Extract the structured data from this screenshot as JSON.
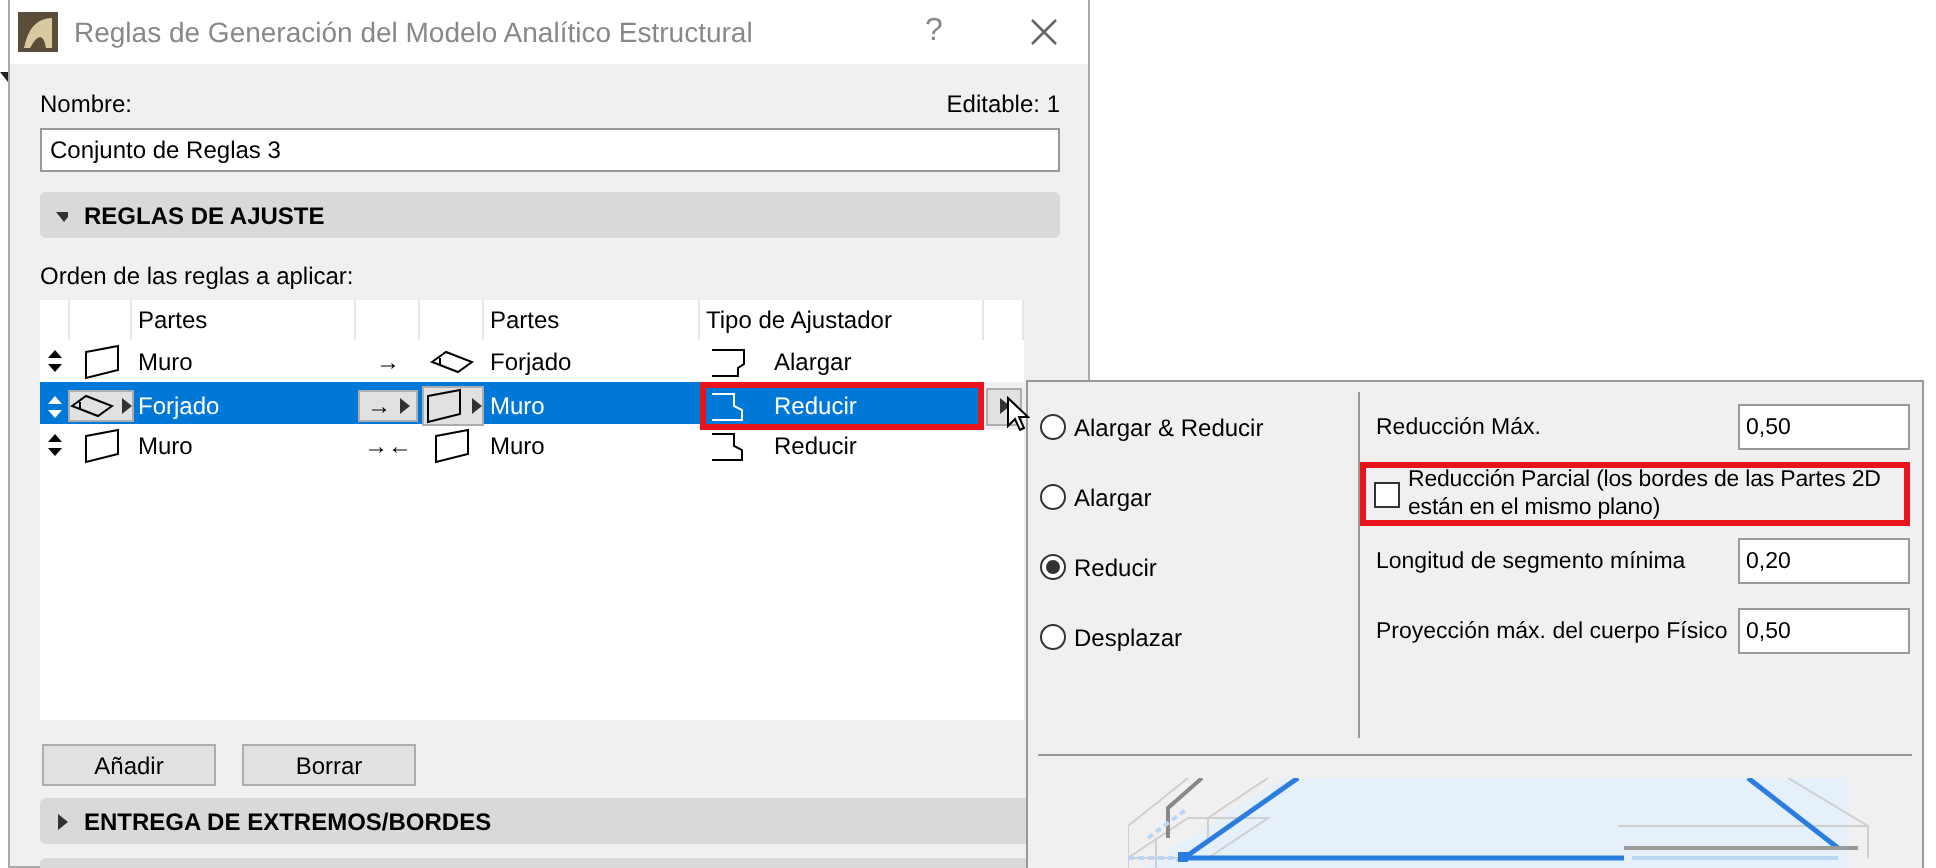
{
  "window": {
    "title": "Reglas de Generación del Modelo Analítico Estructural",
    "help": "?"
  },
  "name_label": "Nombre:",
  "editable": "Editable: 1",
  "name_value": "Conjunto de Reglas 3",
  "sections": [
    {
      "label": "REGLAS DE AJUSTE",
      "expanded": true
    },
    {
      "label": "ENTREGA DE EXTREMOS/BORDES",
      "expanded": false
    }
  ],
  "order_label": "Orden de las reglas a aplicar:",
  "table": {
    "columns": [
      "Partes",
      "Partes",
      "Tipo de Ajustador"
    ],
    "rows": [
      {
        "part1": {
          "label": "Muro",
          "kind": "wall"
        },
        "arrow": "→",
        "part2": {
          "label": "Forjado",
          "kind": "slab"
        },
        "adjuster": {
          "label": "Alargar",
          "kind": "extend"
        },
        "selected": false,
        "highlighted": false
      },
      {
        "part1": {
          "label": "Forjado",
          "kind": "slab"
        },
        "arrow": "→",
        "part2": {
          "label": "Muro",
          "kind": "wall"
        },
        "adjuster": {
          "label": "Reducir",
          "kind": "trim"
        },
        "selected": true,
        "highlighted": true
      },
      {
        "part1": {
          "label": "Muro",
          "kind": "wall"
        },
        "arrow": "→←",
        "part2": {
          "label": "Muro",
          "kind": "wall"
        },
        "adjuster": {
          "label": "Reducir",
          "kind": "trim"
        },
        "selected": false,
        "highlighted": false
      }
    ]
  },
  "buttons": [
    "Añadir",
    "Borrar"
  ],
  "popup": {
    "options": [
      {
        "label": "Alargar & Reducir",
        "selected": false
      },
      {
        "label": "Alargar",
        "selected": false
      },
      {
        "label": "Reducir",
        "selected": true
      },
      {
        "label": "Desplazar",
        "selected": false
      }
    ],
    "settings": [
      {
        "kind": "field",
        "label": "Reducción Máx.",
        "value": "0,50"
      },
      {
        "kind": "checkbox",
        "label": "Reducción Parcial (los bordes de las Partes 2D están en el mismo plano)",
        "checked": false,
        "highlighted": true
      },
      {
        "kind": "field",
        "label": "Longitud de segmento mínima",
        "value": "0,20"
      },
      {
        "kind": "field",
        "label": "Proyección máx. del cuerpo Físico",
        "value": "0,50"
      }
    ]
  }
}
